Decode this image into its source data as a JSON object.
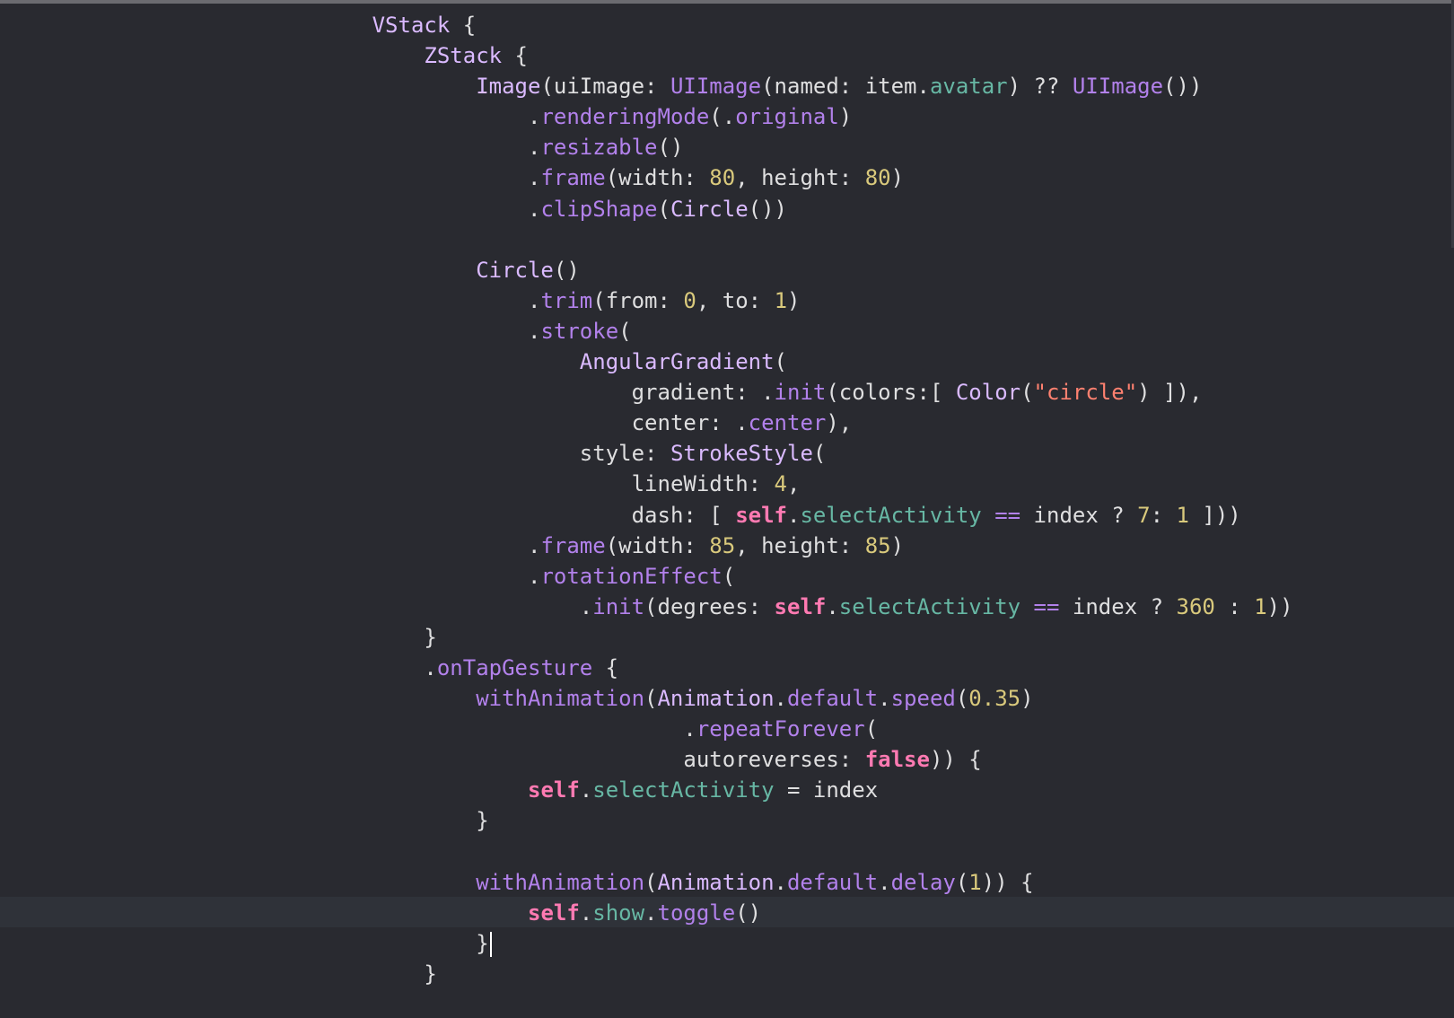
{
  "editor": {
    "theme": {
      "background": "#292a30",
      "current_line": "#2f3239",
      "plain": "#dfdfe0",
      "type": "#dabaff",
      "method": "#b281eb",
      "property": "#67b7a4",
      "number": "#d9c97c",
      "string": "#ff8170",
      "keyword": "#ff7ab2"
    },
    "cursor": {
      "line": 30,
      "after_text": "self.show.toggle()"
    },
    "lines": [
      {
        "indent": 28,
        "tokens": [
          {
            "t": "VStack",
            "c": "type"
          },
          {
            "t": " {",
            "c": "plain"
          }
        ]
      },
      {
        "indent": 32,
        "tokens": [
          {
            "t": "ZStack",
            "c": "type"
          },
          {
            "t": " {",
            "c": "plain"
          }
        ]
      },
      {
        "indent": 36,
        "tokens": [
          {
            "t": "Image",
            "c": "type"
          },
          {
            "t": "(uiImage: ",
            "c": "plain"
          },
          {
            "t": "UIImage",
            "c": "method"
          },
          {
            "t": "(named: item.",
            "c": "plain"
          },
          {
            "t": "avatar",
            "c": "prop"
          },
          {
            "t": ") ?? ",
            "c": "plain"
          },
          {
            "t": "UIImage",
            "c": "method"
          },
          {
            "t": "())",
            "c": "plain"
          }
        ]
      },
      {
        "indent": 40,
        "tokens": [
          {
            "t": ".",
            "c": "plain"
          },
          {
            "t": "renderingMode",
            "c": "method"
          },
          {
            "t": "(.",
            "c": "plain"
          },
          {
            "t": "original",
            "c": "method"
          },
          {
            "t": ")",
            "c": "plain"
          }
        ]
      },
      {
        "indent": 40,
        "tokens": [
          {
            "t": ".",
            "c": "plain"
          },
          {
            "t": "resizable",
            "c": "method"
          },
          {
            "t": "()",
            "c": "plain"
          }
        ]
      },
      {
        "indent": 40,
        "tokens": [
          {
            "t": ".",
            "c": "plain"
          },
          {
            "t": "frame",
            "c": "method"
          },
          {
            "t": "(width: ",
            "c": "plain"
          },
          {
            "t": "80",
            "c": "num"
          },
          {
            "t": ", height: ",
            "c": "plain"
          },
          {
            "t": "80",
            "c": "num"
          },
          {
            "t": ")",
            "c": "plain"
          }
        ]
      },
      {
        "indent": 40,
        "tokens": [
          {
            "t": ".",
            "c": "plain"
          },
          {
            "t": "clipShape",
            "c": "method"
          },
          {
            "t": "(",
            "c": "plain"
          },
          {
            "t": "Circle",
            "c": "type"
          },
          {
            "t": "())",
            "c": "plain"
          }
        ]
      },
      {
        "indent": 0,
        "tokens": []
      },
      {
        "indent": 36,
        "tokens": [
          {
            "t": "Circle",
            "c": "type"
          },
          {
            "t": "()",
            "c": "plain"
          }
        ]
      },
      {
        "indent": 40,
        "tokens": [
          {
            "t": ".",
            "c": "plain"
          },
          {
            "t": "trim",
            "c": "method"
          },
          {
            "t": "(from: ",
            "c": "plain"
          },
          {
            "t": "0",
            "c": "num"
          },
          {
            "t": ", to: ",
            "c": "plain"
          },
          {
            "t": "1",
            "c": "num"
          },
          {
            "t": ")",
            "c": "plain"
          }
        ]
      },
      {
        "indent": 40,
        "tokens": [
          {
            "t": ".",
            "c": "plain"
          },
          {
            "t": "stroke",
            "c": "method"
          },
          {
            "t": "(",
            "c": "plain"
          }
        ]
      },
      {
        "indent": 44,
        "tokens": [
          {
            "t": "AngularGradient",
            "c": "type"
          },
          {
            "t": "(",
            "c": "plain"
          }
        ]
      },
      {
        "indent": 48,
        "tokens": [
          {
            "t": "gradient: .",
            "c": "plain"
          },
          {
            "t": "init",
            "c": "method"
          },
          {
            "t": "(colors:[ ",
            "c": "plain"
          },
          {
            "t": "Color",
            "c": "type"
          },
          {
            "t": "(",
            "c": "plain"
          },
          {
            "t": "\"circle\"",
            "c": "str"
          },
          {
            "t": ") ]),",
            "c": "plain"
          }
        ]
      },
      {
        "indent": 48,
        "tokens": [
          {
            "t": "center: .",
            "c": "plain"
          },
          {
            "t": "center",
            "c": "method"
          },
          {
            "t": "),",
            "c": "plain"
          }
        ]
      },
      {
        "indent": 44,
        "tokens": [
          {
            "t": "style: ",
            "c": "plain"
          },
          {
            "t": "StrokeStyle",
            "c": "type"
          },
          {
            "t": "(",
            "c": "plain"
          }
        ]
      },
      {
        "indent": 48,
        "tokens": [
          {
            "t": "lineWidth: ",
            "c": "plain"
          },
          {
            "t": "4",
            "c": "num"
          },
          {
            "t": ",",
            "c": "plain"
          }
        ]
      },
      {
        "indent": 48,
        "tokens": [
          {
            "t": "dash: [ ",
            "c": "plain"
          },
          {
            "t": "self",
            "c": "kw"
          },
          {
            "t": ".",
            "c": "plain"
          },
          {
            "t": "selectActivity",
            "c": "prop"
          },
          {
            "t": " ",
            "c": "plain"
          },
          {
            "t": "==",
            "c": "method"
          },
          {
            "t": " index ? ",
            "c": "plain"
          },
          {
            "t": "7",
            "c": "num"
          },
          {
            "t": ": ",
            "c": "plain"
          },
          {
            "t": "1",
            "c": "num"
          },
          {
            "t": " ]))",
            "c": "plain"
          }
        ]
      },
      {
        "indent": 40,
        "tokens": [
          {
            "t": ".",
            "c": "plain"
          },
          {
            "t": "frame",
            "c": "method"
          },
          {
            "t": "(width: ",
            "c": "plain"
          },
          {
            "t": "85",
            "c": "num"
          },
          {
            "t": ", height: ",
            "c": "plain"
          },
          {
            "t": "85",
            "c": "num"
          },
          {
            "t": ")",
            "c": "plain"
          }
        ]
      },
      {
        "indent": 40,
        "tokens": [
          {
            "t": ".",
            "c": "plain"
          },
          {
            "t": "rotationEffect",
            "c": "method"
          },
          {
            "t": "(",
            "c": "plain"
          }
        ]
      },
      {
        "indent": 44,
        "tokens": [
          {
            "t": ".",
            "c": "plain"
          },
          {
            "t": "init",
            "c": "method"
          },
          {
            "t": "(degrees: ",
            "c": "plain"
          },
          {
            "t": "self",
            "c": "kw"
          },
          {
            "t": ".",
            "c": "plain"
          },
          {
            "t": "selectActivity",
            "c": "prop"
          },
          {
            "t": " ",
            "c": "plain"
          },
          {
            "t": "==",
            "c": "method"
          },
          {
            "t": " index ? ",
            "c": "plain"
          },
          {
            "t": "360",
            "c": "num"
          },
          {
            "t": " : ",
            "c": "plain"
          },
          {
            "t": "1",
            "c": "num"
          },
          {
            "t": "))",
            "c": "plain"
          }
        ]
      },
      {
        "indent": 32,
        "tokens": [
          {
            "t": "}",
            "c": "plain"
          }
        ]
      },
      {
        "indent": 32,
        "tokens": [
          {
            "t": ".",
            "c": "plain"
          },
          {
            "t": "onTapGesture",
            "c": "method"
          },
          {
            "t": " {",
            "c": "plain"
          }
        ]
      },
      {
        "indent": 36,
        "tokens": [
          {
            "t": "withAnimation",
            "c": "method"
          },
          {
            "t": "(",
            "c": "plain"
          },
          {
            "t": "Animation",
            "c": "type"
          },
          {
            "t": ".",
            "c": "plain"
          },
          {
            "t": "default",
            "c": "method"
          },
          {
            "t": ".",
            "c": "plain"
          },
          {
            "t": "speed",
            "c": "method"
          },
          {
            "t": "(",
            "c": "plain"
          },
          {
            "t": "0.35",
            "c": "num"
          },
          {
            "t": ")",
            "c": "plain"
          }
        ]
      },
      {
        "indent": 52,
        "tokens": [
          {
            "t": ".",
            "c": "plain"
          },
          {
            "t": "repeatForever",
            "c": "method"
          },
          {
            "t": "(",
            "c": "plain"
          }
        ]
      },
      {
        "indent": 52,
        "tokens": [
          {
            "t": "autoreverses: ",
            "c": "plain"
          },
          {
            "t": "false",
            "c": "kw"
          },
          {
            "t": ")) {",
            "c": "plain"
          }
        ]
      },
      {
        "indent": 40,
        "tokens": [
          {
            "t": "self",
            "c": "kw"
          },
          {
            "t": ".",
            "c": "plain"
          },
          {
            "t": "selectActivity",
            "c": "prop"
          },
          {
            "t": " = index",
            "c": "plain"
          }
        ]
      },
      {
        "indent": 36,
        "tokens": [
          {
            "t": "}",
            "c": "plain"
          }
        ]
      },
      {
        "indent": 0,
        "tokens": []
      },
      {
        "indent": 36,
        "tokens": [
          {
            "t": "withAnimation",
            "c": "method"
          },
          {
            "t": "(",
            "c": "plain"
          },
          {
            "t": "Animation",
            "c": "type"
          },
          {
            "t": ".",
            "c": "plain"
          },
          {
            "t": "default",
            "c": "method"
          },
          {
            "t": ".",
            "c": "plain"
          },
          {
            "t": "delay",
            "c": "method"
          },
          {
            "t": "(",
            "c": "plain"
          },
          {
            "t": "1",
            "c": "num"
          },
          {
            "t": ")) {",
            "c": "plain"
          }
        ]
      },
      {
        "indent": 40,
        "tokens": [
          {
            "t": "self",
            "c": "kw"
          },
          {
            "t": ".",
            "c": "plain"
          },
          {
            "t": "show",
            "c": "prop"
          },
          {
            "t": ".",
            "c": "plain"
          },
          {
            "t": "toggle",
            "c": "method"
          },
          {
            "t": "()",
            "c": "plain"
          }
        ]
      },
      {
        "indent": 36,
        "tokens": [
          {
            "t": "}",
            "c": "plain"
          }
        ]
      },
      {
        "indent": 32,
        "tokens": [
          {
            "t": "}",
            "c": "plain"
          }
        ]
      }
    ]
  }
}
